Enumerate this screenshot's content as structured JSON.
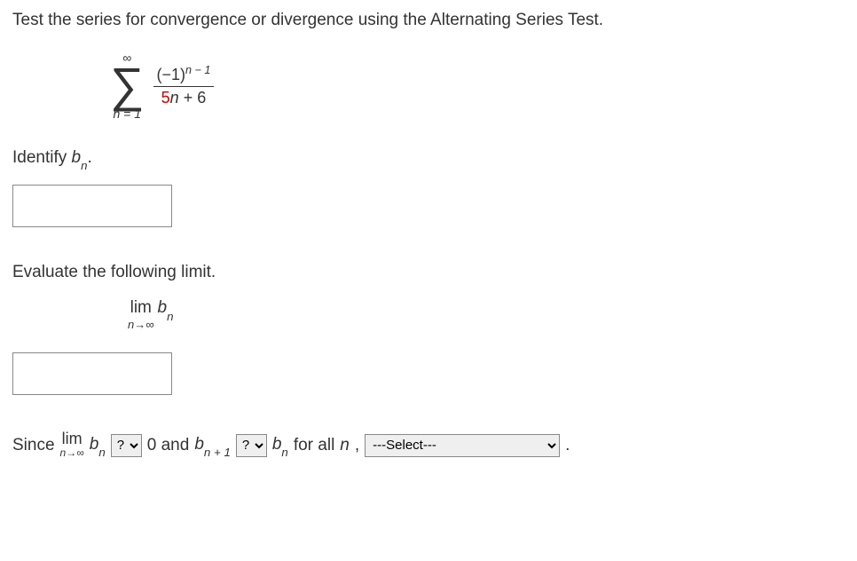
{
  "problem": "Test the series for convergence or divergence using the Alternating Series Test.",
  "series": {
    "upper": "∞",
    "lower_left": "n",
    "lower_eq": " = 1",
    "num_base": "(−1)",
    "num_exp": "n − 1",
    "den_const1": "5",
    "den_var": "n",
    "den_rest": " + 6"
  },
  "identify": {
    "label_pre": "Identify ",
    "bvar": "b",
    "bsub": "n",
    "label_post": "."
  },
  "evaluate": {
    "label": "Evaluate the following limit.",
    "lim": "lim",
    "limsub_left": "n",
    "limsub_arrow": "→∞",
    "bvar": "b",
    "bsub": "n"
  },
  "conclusion": {
    "since": "Since ",
    "lim": "lim",
    "limsub_left": "n",
    "limsub_arrow": "→∞",
    "bvar": "b",
    "bsub_n": "n",
    "zero_and": " 0 and ",
    "bsub_n1": "n + 1",
    "for_all": " for all ",
    "nvar": "n",
    "comma": ", ",
    "period": " ."
  },
  "selects": {
    "placeholder_q": "?",
    "placeholder_select": "---Select---"
  }
}
